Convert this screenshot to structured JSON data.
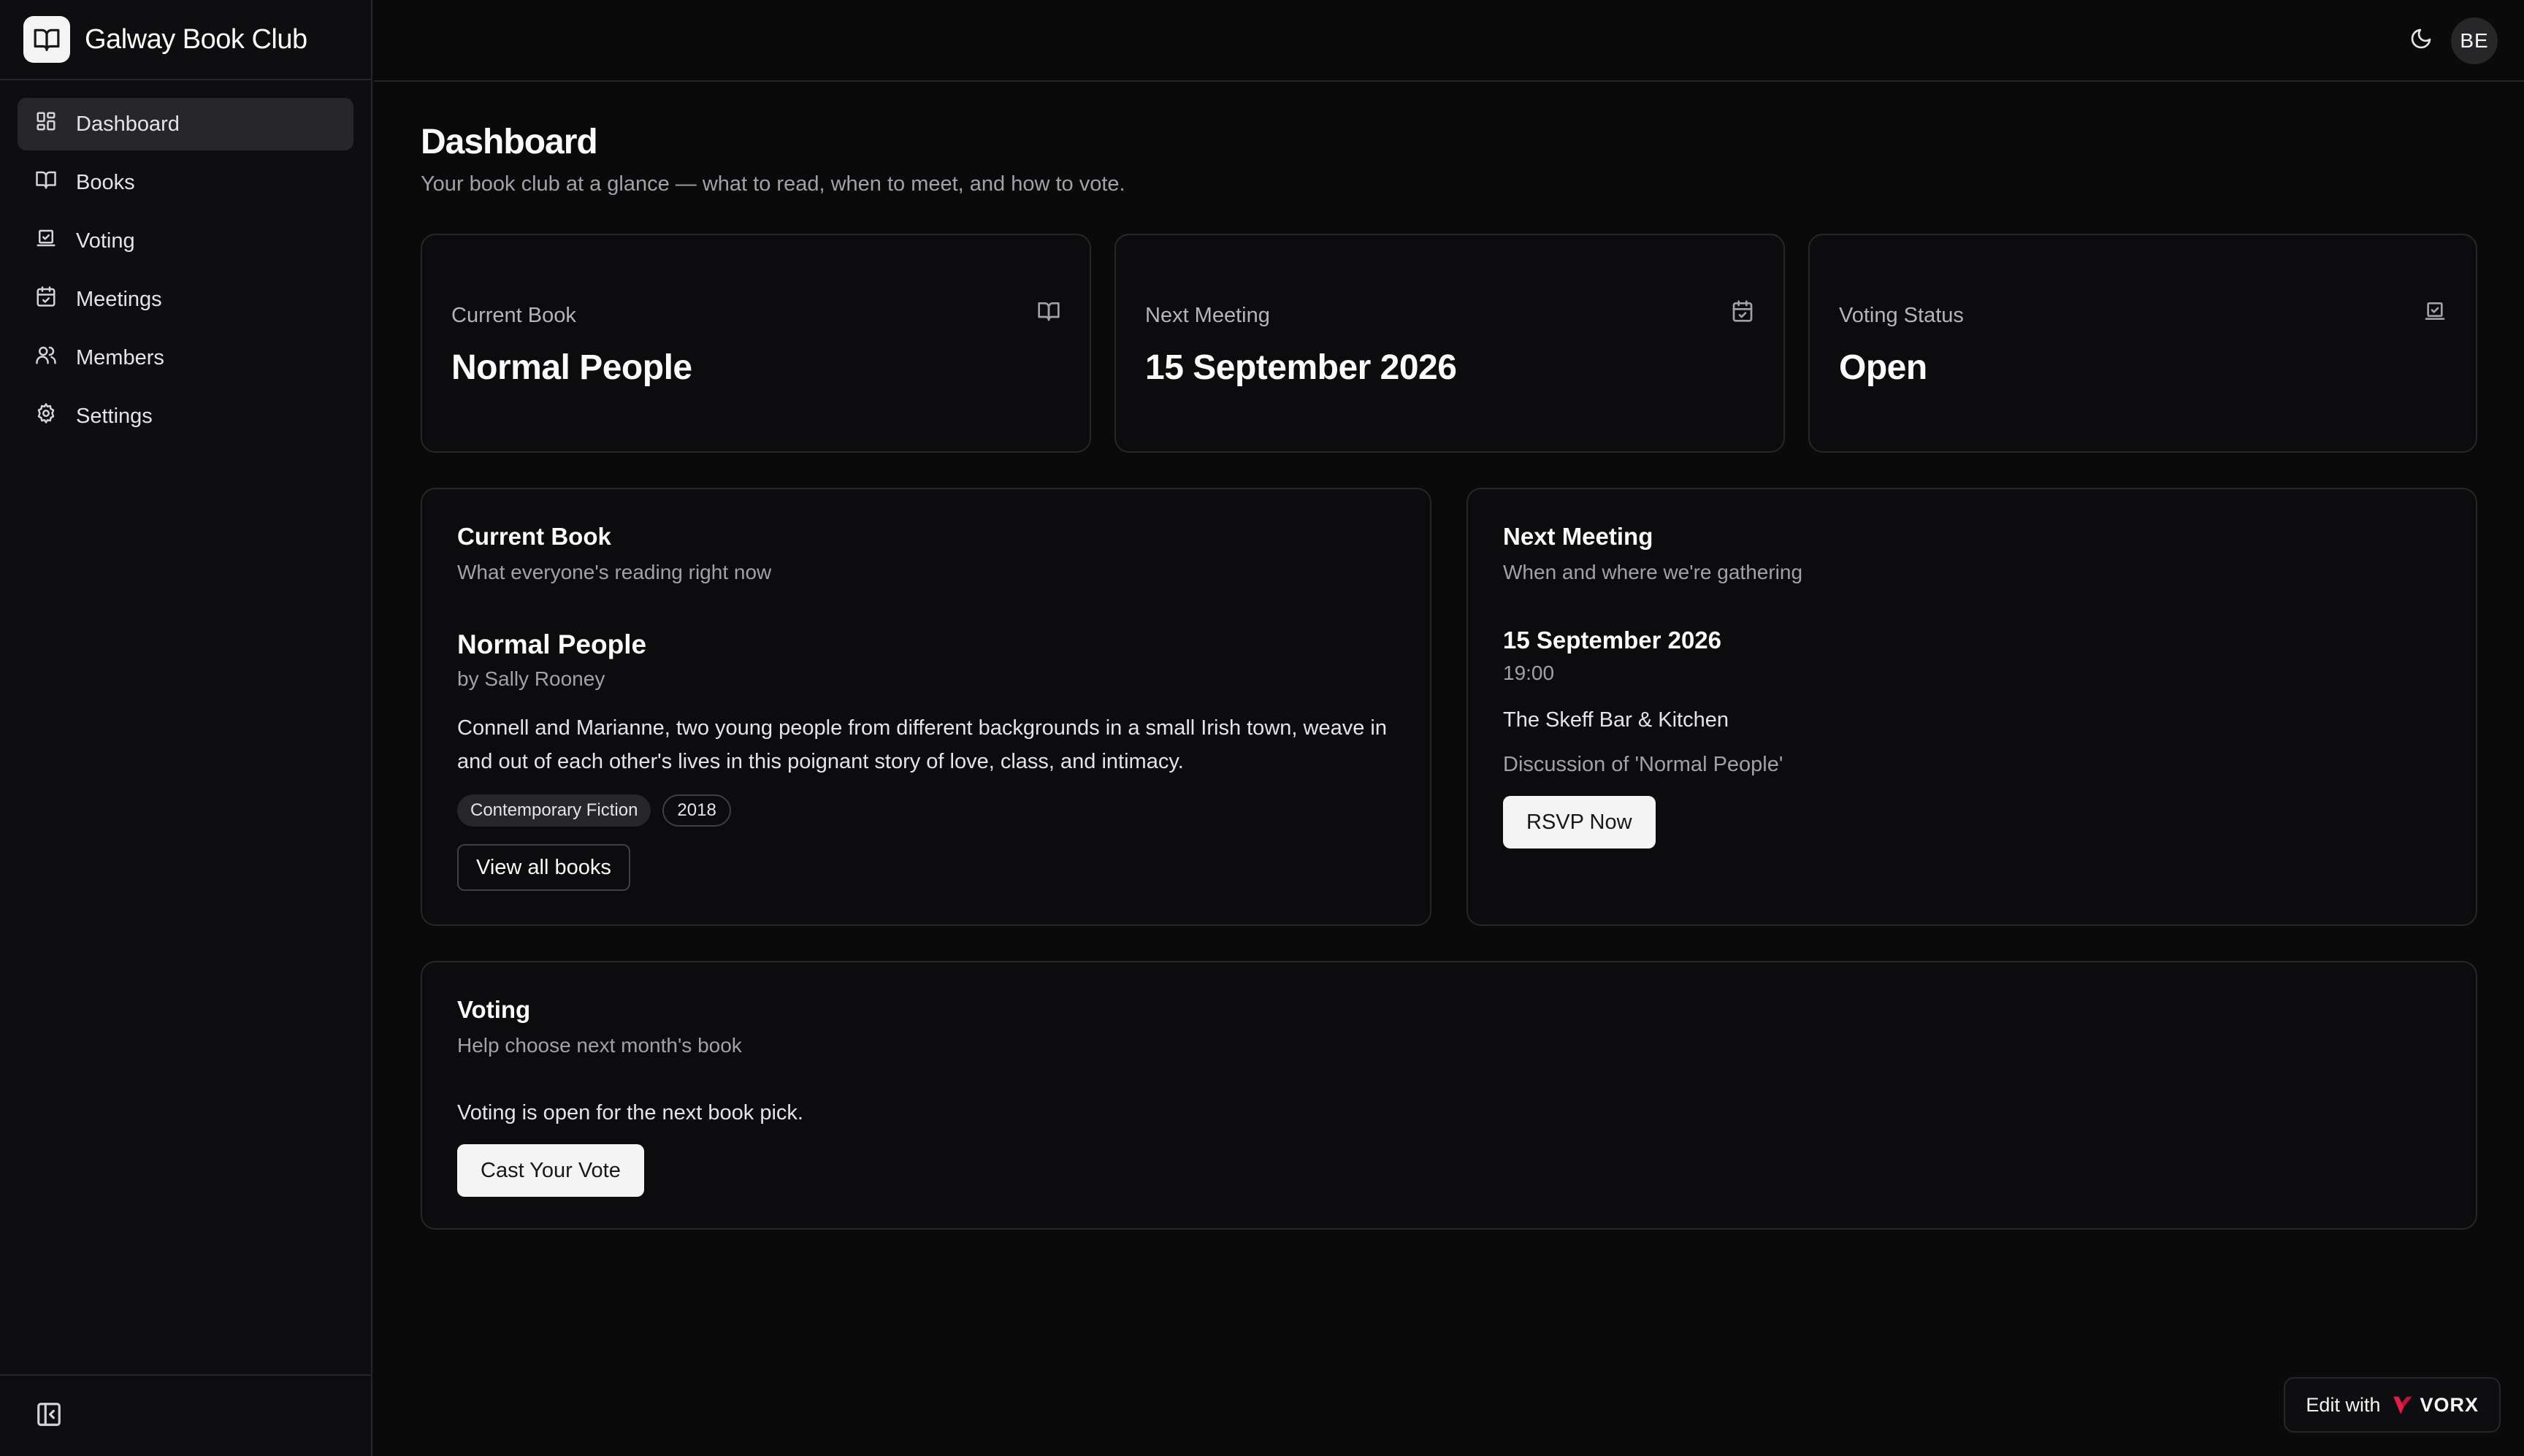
{
  "app": {
    "name": "Galway Book Club"
  },
  "sidebar": {
    "items": [
      {
        "label": "Dashboard",
        "icon": "layout-dashboard-icon",
        "active": true
      },
      {
        "label": "Books",
        "icon": "book-open-icon"
      },
      {
        "label": "Voting",
        "icon": "vote-icon"
      },
      {
        "label": "Meetings",
        "icon": "calendar-check-icon"
      },
      {
        "label": "Members",
        "icon": "users-icon"
      },
      {
        "label": "Settings",
        "icon": "gear-icon"
      }
    ],
    "collapse_icon": "panel-left-close-icon"
  },
  "header": {
    "theme_icon": "moon-icon",
    "avatar_initials": "BE"
  },
  "page": {
    "title": "Dashboard",
    "subtitle": "Your book club at a glance — what to read, when to meet, and how to vote."
  },
  "stats": [
    {
      "label": "Current Book",
      "value": "Normal People",
      "icon": "book-open-icon"
    },
    {
      "label": "Next Meeting",
      "value": "15 September 2026",
      "icon": "calendar-check-icon"
    },
    {
      "label": "Voting Status",
      "value": "Open",
      "icon": "vote-icon"
    }
  ],
  "current_book": {
    "title": "Current Book",
    "description": "What everyone's reading right now",
    "book_title": "Normal People",
    "author": "by Sally Rooney",
    "summary": "Connell and Marianne, two young people from different backgrounds in a small Irish town, weave in and out of each other's lives in this poignant story of love, class, and intimacy.",
    "genre": "Contemporary Fiction",
    "year": "2018",
    "button_label": "View all books"
  },
  "next_meeting": {
    "title": "Next Meeting",
    "description": "When and where we're gathering",
    "date": "15 September 2026",
    "time": "19:00",
    "location": "The Skeff Bar & Kitchen",
    "topic": "Discussion of 'Normal People'",
    "button_label": "RSVP Now"
  },
  "voting": {
    "title": "Voting",
    "description": "Help choose next month's book",
    "status_text": "Voting is open for the next book pick.",
    "button_label": "Cast Your Vote"
  },
  "edit_badge": {
    "label": "Edit with",
    "brand": "VORX",
    "accent_color": "#e11d48"
  },
  "colors": {
    "background": "#0a0a0b",
    "sidebar": "#0e0e11",
    "border": "#27272a",
    "active_item": "#27272a",
    "primary_button": "#f4f4f5"
  }
}
